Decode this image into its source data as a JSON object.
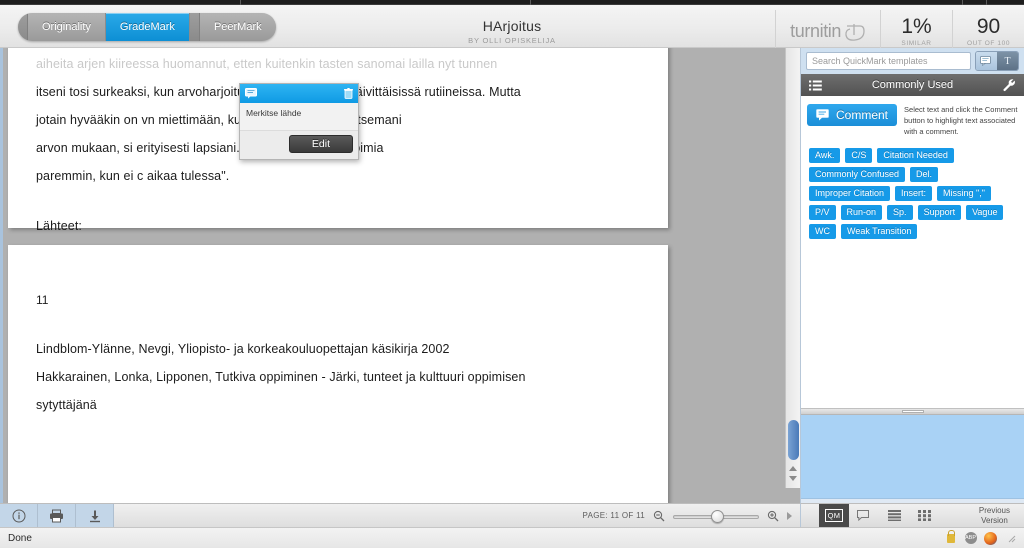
{
  "header": {
    "view_tabs": [
      {
        "label": "Originality",
        "active": false
      },
      {
        "label": "GradeMark",
        "active": true
      },
      {
        "label": "PeerMark",
        "active": false
      }
    ],
    "document_title": "HArjoitus",
    "byline": "BY OLLI OPISKELIJA",
    "brand": "turnitin",
    "similarity": {
      "value": "1%",
      "label": "SIMILAR"
    },
    "grade": {
      "value": "90",
      "label": "OUT OF 100"
    }
  },
  "document": {
    "page1": {
      "clipped_line": "aiheita arjen kiireessa huomannut, etten kuitenkin tasten sanomai lailla nyt tunnen",
      "lines": [
        "itseni tosi surkeaksi, kun arvoharjoitus meinaa unohtua päivittäisissä rutiineissa. Mutta",
        "jotain hyvääkin on                              vn miettimään, kun en ole toiminut valitsemani",
        "arvon  mukaan,  si                       erityisesti  lapsiani.  Arvoharjoitus  voisi  toimia",
        "paremmin, kun ei c                 aikaa tulessa\"."
      ],
      "heading": "Lähteet:"
    },
    "page2": {
      "page_number": "11",
      "references": [
        "Lindblom-Ylänne, Nevgi, Yliopisto- ja korkeakouluopettajan käsikirja 2002",
        "Hakkarainen, Lonka, Lipponen, Tutkiva oppiminen - Järki, tunteet ja kulttuuri oppimisen",
        "sytyttäjänä"
      ]
    }
  },
  "comment_popup": {
    "icon": "comment-bubble-icon",
    "delete_icon": "trash-icon",
    "text": "Merkitse lähde",
    "edit_label": "Edit"
  },
  "doc_toolbar": {
    "buttons": [
      {
        "name": "info-icon",
        "title": "Information"
      },
      {
        "name": "print-icon",
        "title": "Print"
      },
      {
        "name": "download-icon",
        "title": "Download"
      }
    ],
    "page_label": "PAGE: 11 OF 11",
    "zoom_out_icon": "zoom-out-icon",
    "zoom_in_icon": "zoom-in-icon"
  },
  "sidebar": {
    "search_placeholder": "Search QuickMark templates",
    "toggle_comment_icon": "comment-bubble-icon",
    "toggle_text_icon": "text-T-icon",
    "set_header": {
      "list_icon": "list-icon",
      "title": "Commonly Used",
      "wrench_icon": "wrench-icon"
    },
    "comment_button": "Comment",
    "comment_hint": "Select text and click the Comment button to highlight text associated with a comment.",
    "quickmarks": [
      "Awk.",
      "C/S",
      "Citation Needed",
      "Commonly Confused",
      "Del.",
      "Improper Citation",
      "Insert:",
      "Missing \",\"",
      "P/V",
      "Run-on",
      "Sp.",
      "Support",
      "Vague",
      "WC",
      "Weak Transition"
    ]
  },
  "sidebar_footer": {
    "tabs": [
      {
        "name": "quickmark-tab",
        "label": "QM",
        "active": true
      },
      {
        "name": "comment-tab",
        "label": "comment-icon",
        "active": false
      },
      {
        "name": "rubric-tab",
        "label": "list-icon",
        "active": false
      },
      {
        "name": "grid-tab",
        "label": "grid-icon",
        "active": false
      }
    ],
    "previous_version_line1": "Previous",
    "previous_version_line2": "Version"
  },
  "status_bar": {
    "text": "Done",
    "icons": [
      "lock-icon",
      "adblock-icon",
      "firefox-icon"
    ]
  },
  "colors": {
    "accent_blue": "#169ae8",
    "tab_active": "#0d8fd4",
    "rubric_panel": "#a9d2f5",
    "paper": "#ffffff",
    "viewport_bg": "#b0b0b0"
  }
}
